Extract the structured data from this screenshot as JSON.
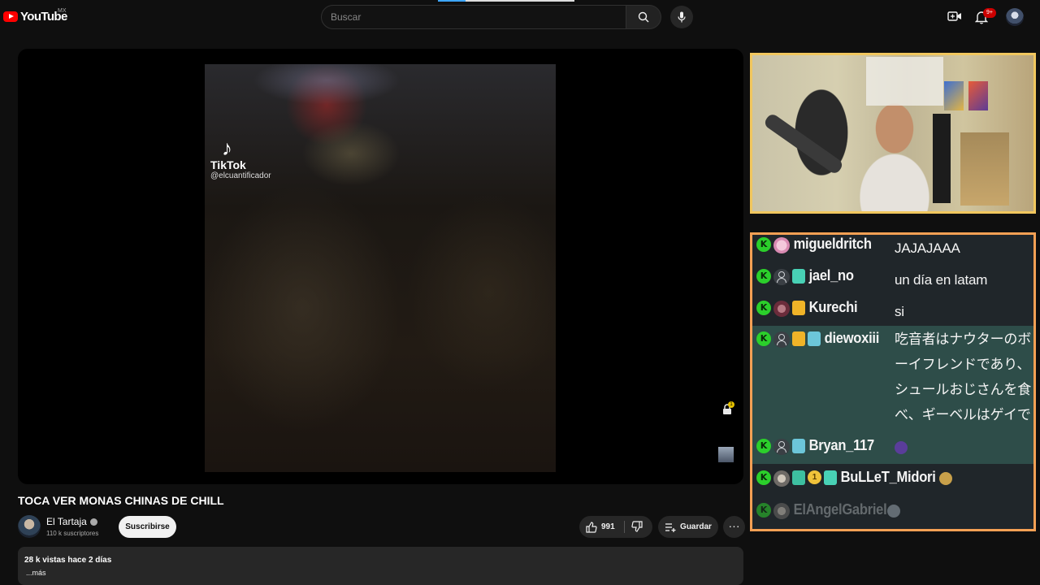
{
  "topbar": {
    "logo_text": "YouTube",
    "country_code": "MX",
    "search_placeholder": "Buscar",
    "notification_count": "9+"
  },
  "video": {
    "overlay_brand": "TikTok",
    "overlay_handle": "@elcuantificador",
    "lock_badge": "1"
  },
  "watch": {
    "title": "TOCA VER MONAS CHINAS DE CHILL",
    "channel_name": "El Tartaja",
    "subscribers": "110 k suscriptores",
    "subscribe_label": "Suscribirse",
    "likes": "991",
    "save_label": "Guardar",
    "more_label": "···",
    "views_date": "28 k vistas  hace 2 días",
    "more_desc": "...más"
  },
  "chat": {
    "messages": [
      {
        "user": "migueldritch",
        "text": "JAJAJAAA"
      },
      {
        "user": "jael_no",
        "text": "un día en latam"
      },
      {
        "user": "Kurechi",
        "text": "si"
      },
      {
        "user": "diewoxiii",
        "text": "吃音者はナウターのボーイフレンドであり、シュールおじさんを食べ、ギーベルはゲイである"
      },
      {
        "user": "Bryan_117",
        "text": ""
      },
      {
        "user": "BuLLeT_Midori",
        "text": ""
      },
      {
        "user": "ElAngelGabriel",
        "text": ""
      }
    ],
    "k_label": "K",
    "coin_label": "1"
  },
  "colors": {
    "youtube_red": "#ff0000",
    "cam_border": "#f1c75e",
    "chat_border": "#f5a054",
    "kick_green": "#2bcf2b"
  }
}
